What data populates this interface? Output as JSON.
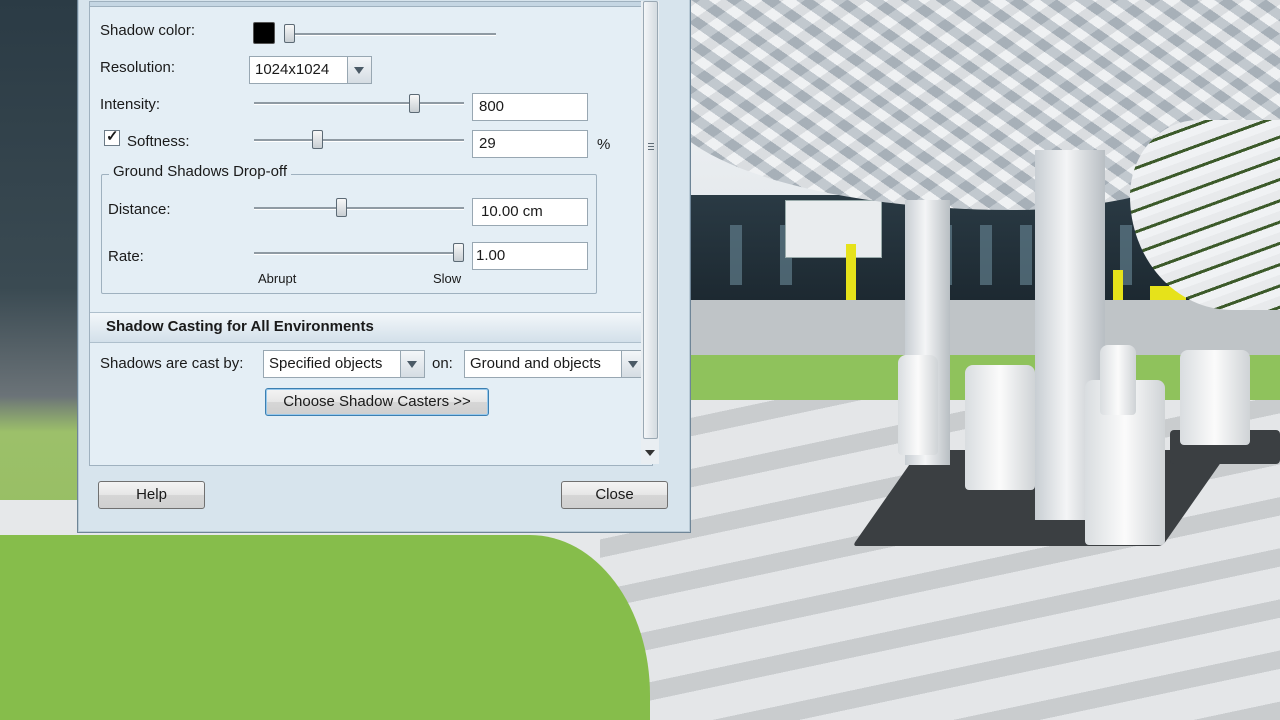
{
  "shadow_settings": {
    "shadow_color_label": "Shadow color:",
    "shadow_color": "#000000",
    "shadow_color_slider": 0.0,
    "resolution_label": "Resolution:",
    "resolution_value": "1024x1024",
    "intensity_label": "Intensity:",
    "intensity_value": "800",
    "intensity_slider": 0.78,
    "softness_checked": true,
    "softness_label": "Softness:",
    "softness_value": "29",
    "softness_unit": "%",
    "softness_slider": 0.29
  },
  "ground_dropoff": {
    "title": "Ground Shadows Drop-off",
    "distance_label": "Distance:",
    "distance_value": "10.00 cm",
    "distance_slider": 0.41,
    "rate_label": "Rate:",
    "rate_value": "1.00",
    "rate_slider": 1.0,
    "rate_min_label": "Abrupt",
    "rate_max_label": "Slow"
  },
  "casting": {
    "section_title": "Shadow Casting for All Environments",
    "cast_by_label": "Shadows are cast by:",
    "cast_by_value": "Specified objects",
    "on_label": "on:",
    "on_value": "Ground and objects",
    "choose_button": "Choose Shadow Casters >>"
  },
  "footer": {
    "help_button": "Help",
    "close_button": "Close"
  },
  "colors": {
    "dialog_bg": "#d7e4ed",
    "panel_bg": "#e4eef5",
    "grass": "#86bd4b"
  }
}
